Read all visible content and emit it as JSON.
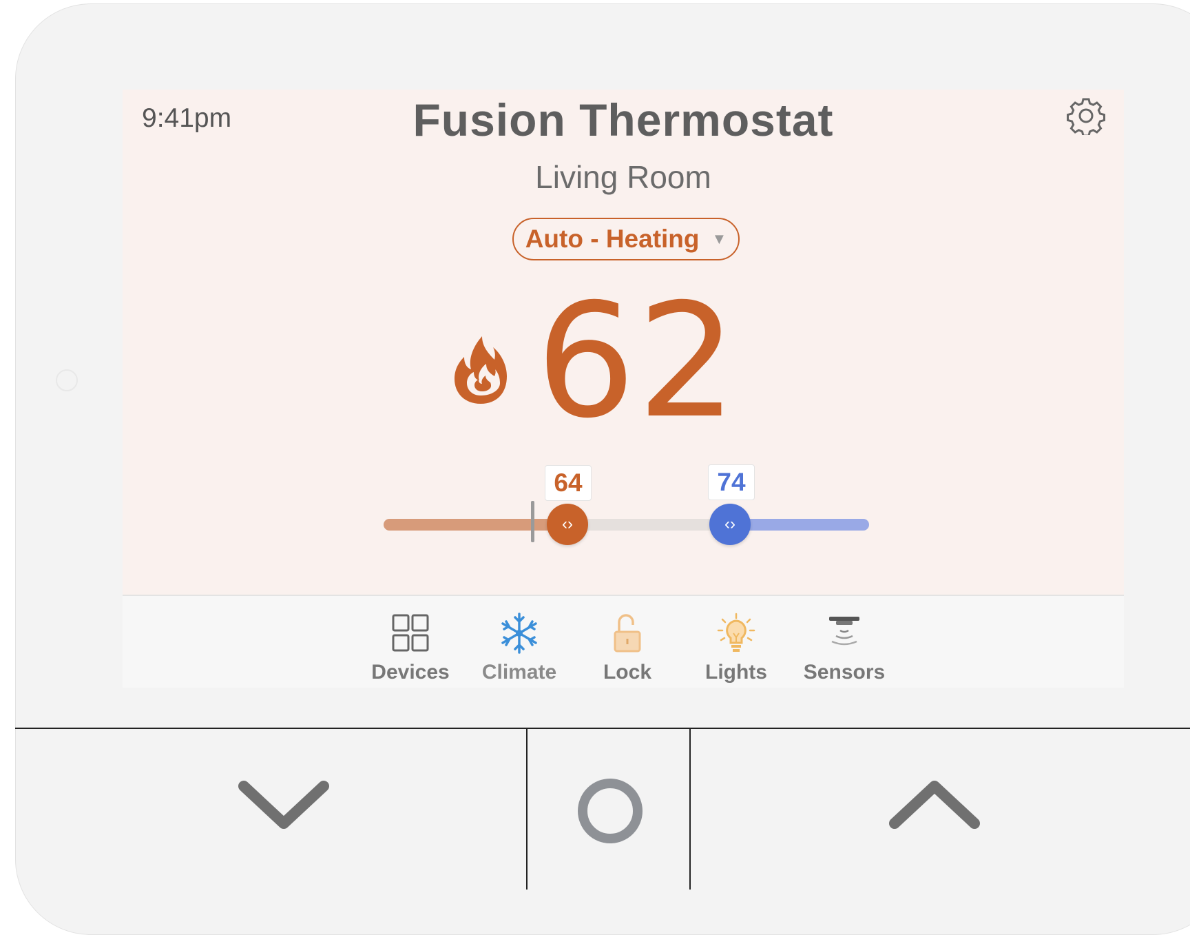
{
  "status": {
    "time": "9:41pm"
  },
  "header": {
    "title": "Fusion Thermostat",
    "room": "Living Room"
  },
  "icons": {
    "settings": "gear-icon",
    "mode_caret": "caret-down-icon",
    "heating": "flame-icon"
  },
  "mode": {
    "label": "Auto - Heating",
    "caret": "▼"
  },
  "temperature": {
    "current": "62"
  },
  "setpoints": {
    "heat": "64",
    "cool": "74",
    "heat_glyph": "‹›",
    "cool_glyph": "‹›"
  },
  "colors": {
    "heat": "#c8622a",
    "cool": "#4f73d6",
    "screen_bg": "#faf1ee",
    "heat_track": "#d79b7a",
    "cool_track": "#99a9e6"
  },
  "nav": {
    "items": [
      {
        "label": "Devices",
        "icon": "grid-icon"
      },
      {
        "label": "Climate",
        "icon": "snowflake-icon",
        "active": true
      },
      {
        "label": "Lock",
        "icon": "lock-icon"
      },
      {
        "label": "Lights",
        "icon": "lightbulb-icon"
      },
      {
        "label": "Sensors",
        "icon": "sensor-icon"
      }
    ]
  },
  "hardware_buttons": [
    {
      "icon": "chevron-down-icon"
    },
    {
      "icon": "circle-icon"
    },
    {
      "icon": "chevron-up-icon"
    }
  ]
}
